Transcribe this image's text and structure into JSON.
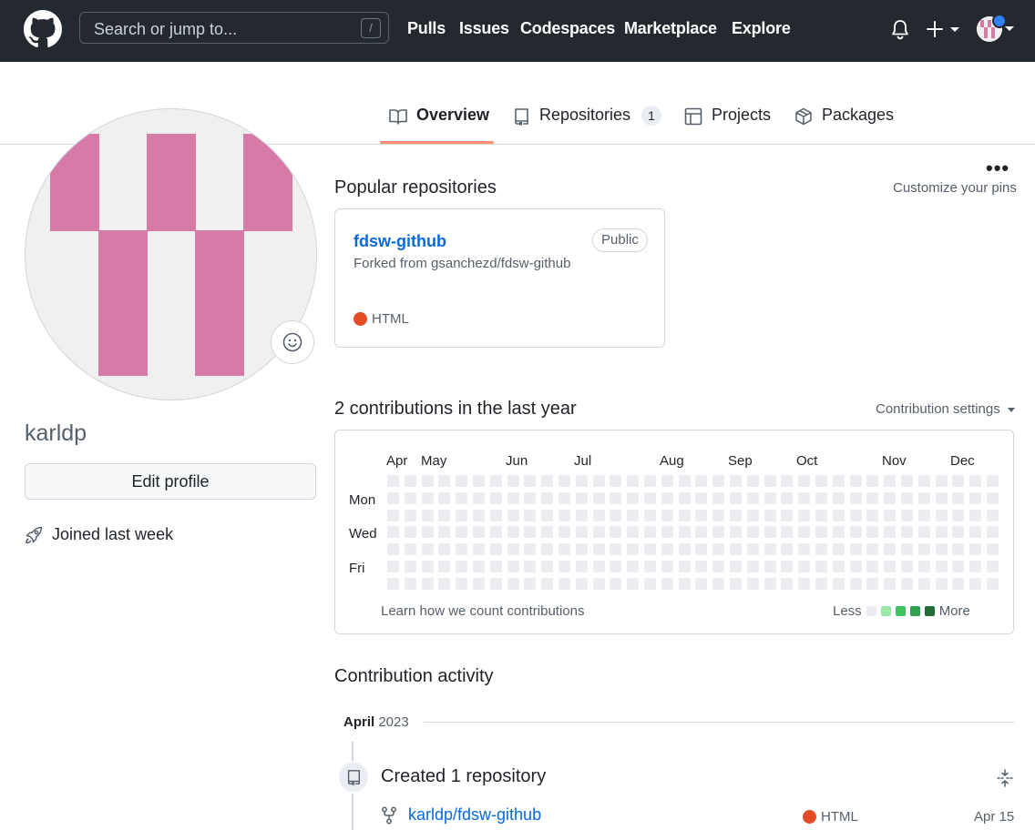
{
  "header": {
    "search_placeholder": "Search or jump to...",
    "search_shortcut": "/",
    "nav": [
      "Pulls",
      "Issues",
      "Codespaces",
      "Marketplace",
      "Explore"
    ],
    "plus_label": "+"
  },
  "tabs": {
    "overview": "Overview",
    "repositories": "Repositories",
    "repositories_count": "1",
    "projects": "Projects",
    "packages": "Packages",
    "more": "•••"
  },
  "profile": {
    "username": "karldp",
    "edit_profile": "Edit profile",
    "joined": "Joined last week"
  },
  "popular": {
    "title": "Popular repositories",
    "customize": "Customize your pins",
    "repo": {
      "name": "fdsw-github",
      "visibility": "Public",
      "forked_from": "Forked from gsanchezd/fdsw-github",
      "language": "HTML",
      "language_color": "#e34c26"
    }
  },
  "contributions": {
    "title": "2 contributions in the last year",
    "settings": "Contribution settings",
    "months": [
      "Apr",
      "May",
      "Jun",
      "Jul",
      "Aug",
      "Sep",
      "Oct",
      "Nov",
      "Dec"
    ],
    "days": [
      "Mon",
      "Wed",
      "Fri"
    ],
    "learn": "Learn how we count contributions",
    "less": "Less",
    "more": "More",
    "legend_colors": [
      "#ebedf0",
      "#9be9a8",
      "#40c463",
      "#30a14e",
      "#216e39"
    ]
  },
  "activity": {
    "title": "Contribution activity",
    "month": "April",
    "year": "2023",
    "created": "Created 1 repository",
    "repo": "karldp/fdsw-github",
    "language": "HTML",
    "date": "Apr 15"
  }
}
